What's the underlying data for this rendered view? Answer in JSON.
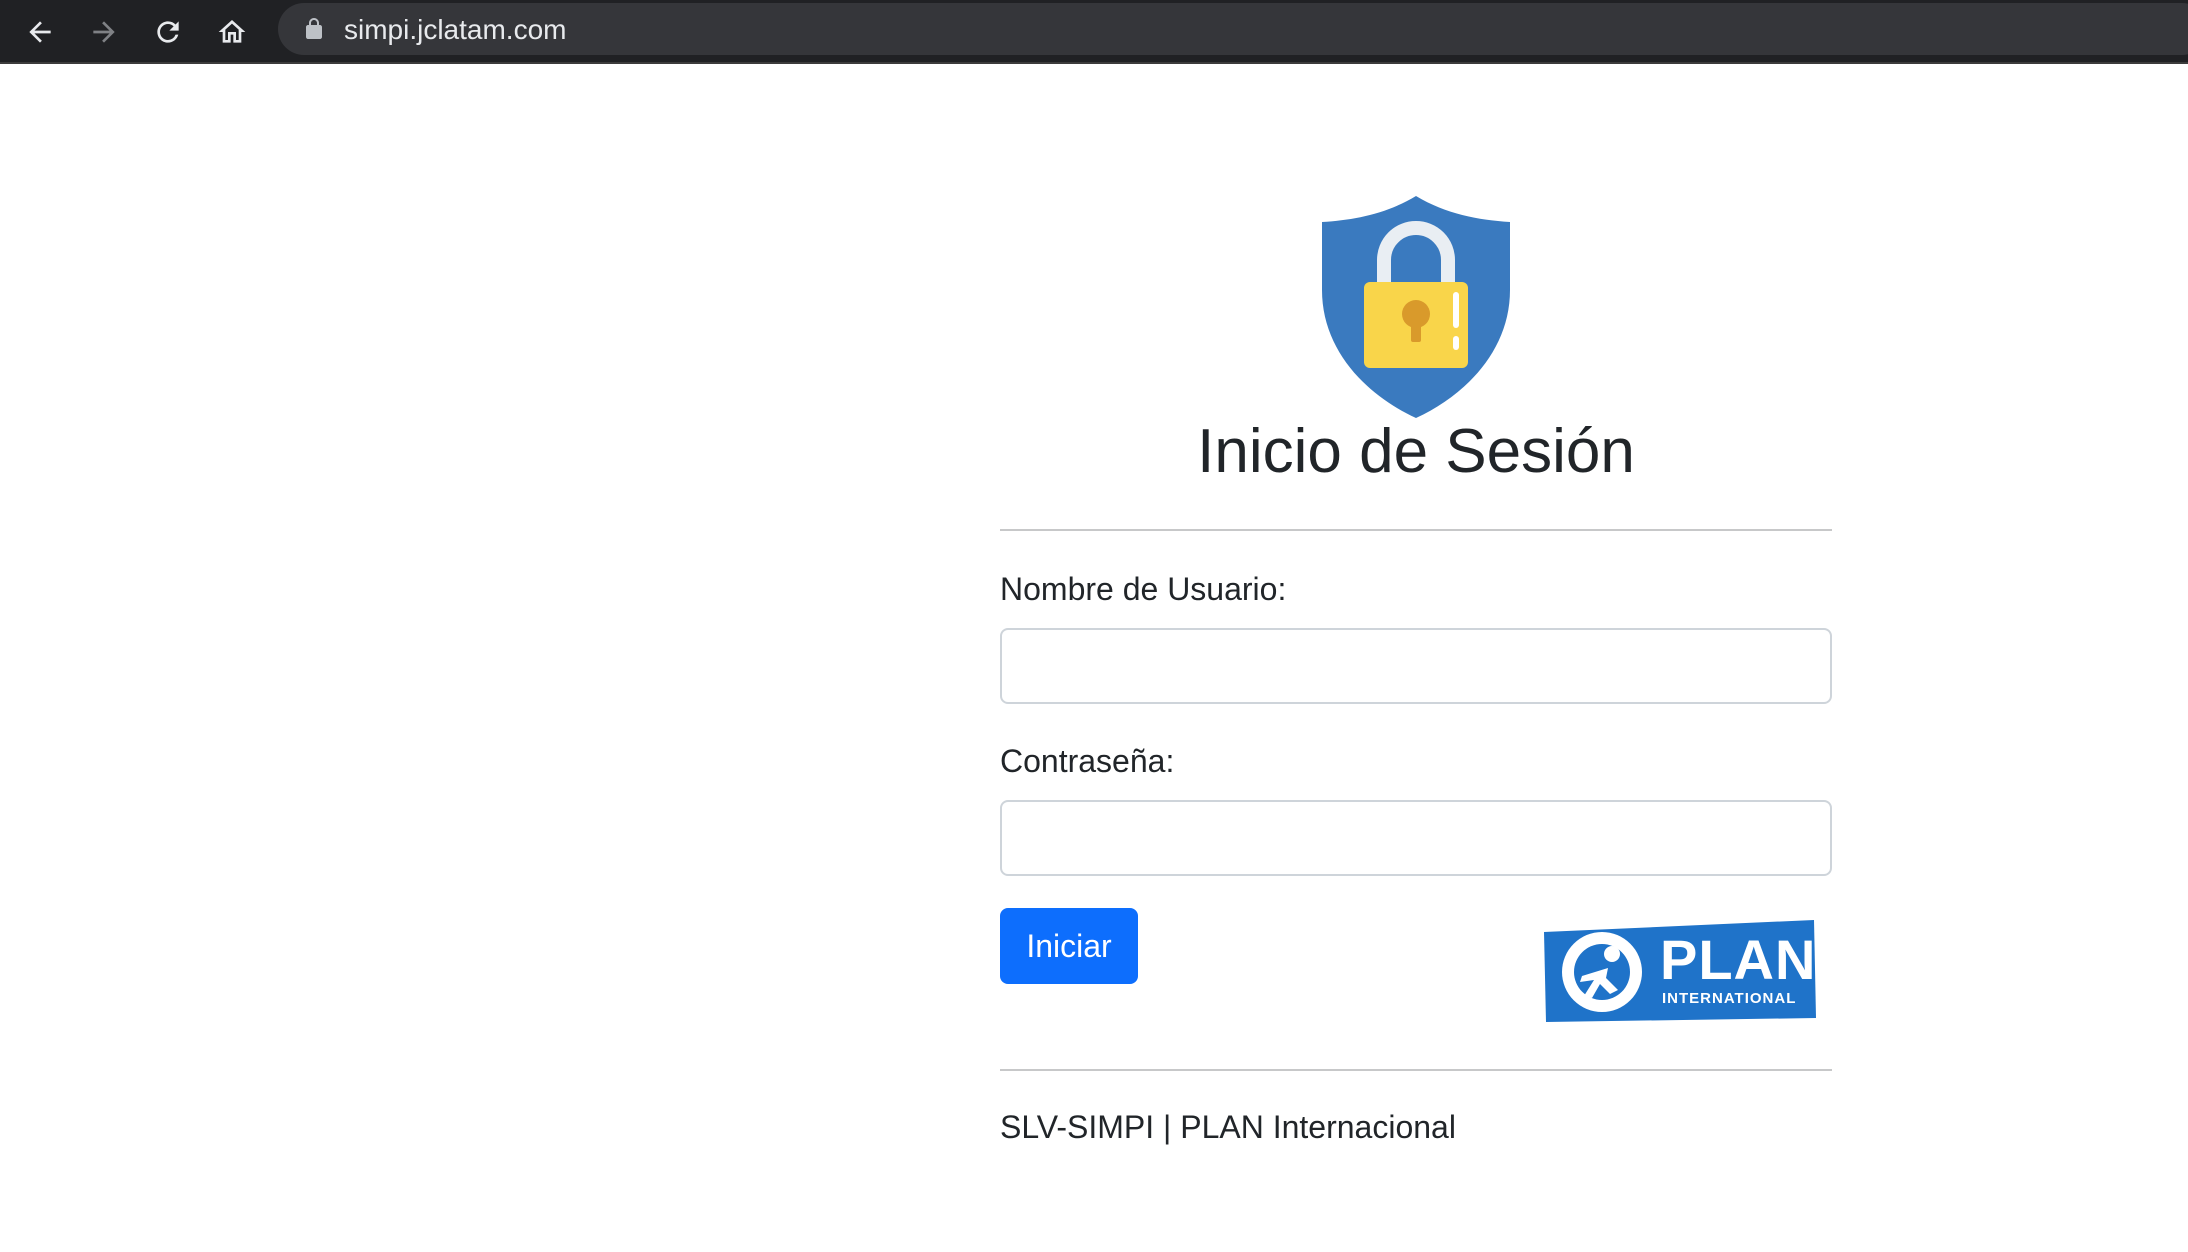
{
  "browser": {
    "url": "simpi.jclatam.com",
    "back_icon": "arrow-left-icon",
    "forward_icon": "arrow-right-icon",
    "reload_icon": "reload-icon",
    "home_icon": "home-icon",
    "lock_icon": "lock-icon"
  },
  "login": {
    "title": "Inicio de Sesión",
    "username_label": "Nombre de Usuario:",
    "username_value": "",
    "password_label": "Contraseña:",
    "password_value": "",
    "submit_label": "Iniciar"
  },
  "logos": {
    "shield": "shield-lock-icon",
    "plan_word": "PLAN",
    "plan_sub": "INTERNATIONAL"
  },
  "footer": {
    "text": "SLV-SIMPI | PLAN Internacional"
  },
  "colors": {
    "primary_button": "#0d6efd",
    "shield_blue": "#3a7abf",
    "lock_yellow": "#f9d54a",
    "plan_blue": "#1f73c9"
  }
}
